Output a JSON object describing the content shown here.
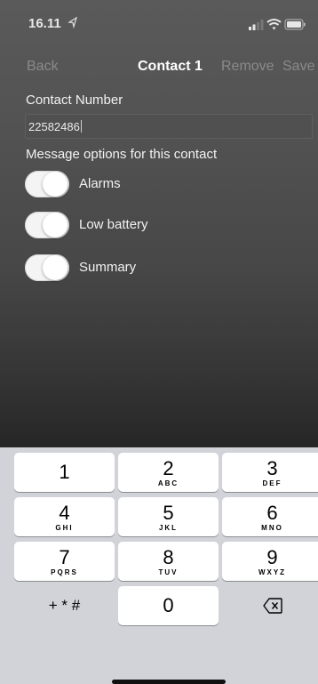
{
  "status_bar": {
    "time": "16.11"
  },
  "nav": {
    "back": "Back",
    "title": "Contact 1",
    "remove": "Remove",
    "save": "Save"
  },
  "form": {
    "contact_number_label": "Contact Number",
    "contact_number_value": "22582486",
    "options_label": "Message options for this contact",
    "toggles": [
      {
        "label": "Alarms",
        "on": true
      },
      {
        "label": "Low battery",
        "on": true
      },
      {
        "label": "Summary",
        "on": true
      }
    ]
  },
  "keypad": {
    "keys": [
      {
        "digit": "1",
        "letters": ""
      },
      {
        "digit": "2",
        "letters": "ABC"
      },
      {
        "digit": "3",
        "letters": "DEF"
      },
      {
        "digit": "4",
        "letters": "GHI"
      },
      {
        "digit": "5",
        "letters": "JKL"
      },
      {
        "digit": "6",
        "letters": "MNO"
      },
      {
        "digit": "7",
        "letters": "PQRS"
      },
      {
        "digit": "8",
        "letters": "TUV"
      },
      {
        "digit": "9",
        "letters": "WXYZ"
      }
    ],
    "symbols": "+ * #",
    "zero": "0"
  },
  "icons": {
    "location": "location-arrow-icon",
    "signal": "cellular-signal-icon",
    "wifi": "wifi-icon",
    "battery": "battery-icon",
    "backspace": "backspace-icon"
  }
}
